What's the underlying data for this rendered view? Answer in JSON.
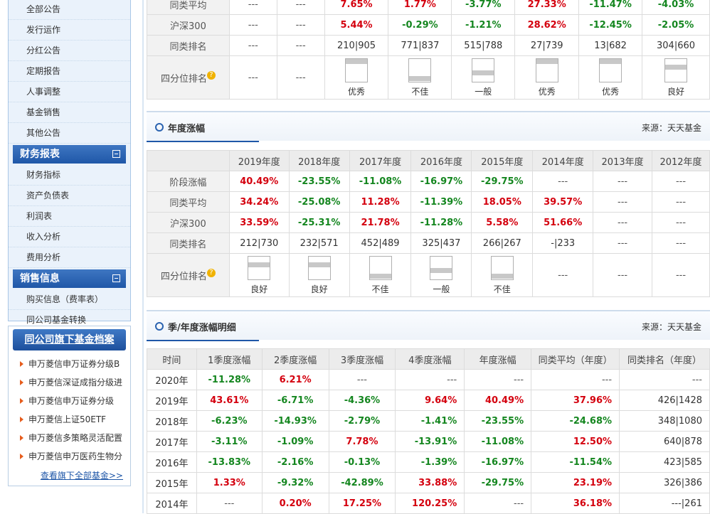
{
  "sidebar": {
    "notice_items": [
      "全部公告",
      "发行运作",
      "分红公告",
      "定期报告",
      "人事调整",
      "基金销售",
      "其他公告"
    ],
    "finance_head": "财务报表",
    "finance_items": [
      "财务指标",
      "资产负债表",
      "利润表",
      "收入分析",
      "费用分析"
    ],
    "sales_head": "销售信息",
    "sales_items": [
      "购买信息（费率表）",
      "同公司基金转换"
    ],
    "fund_head": "同公司旗下基金档案",
    "fund_items": [
      "申万菱信申万证券分级B",
      "申万菱信深证成指分级进",
      "申万菱信申万证券分级",
      "申万菱信上证50ETF",
      "申万菱信多策略灵活配置",
      "申万菱信申万医药生物分"
    ],
    "fund_more": "查看旗下全部基金>>"
  },
  "stage_table": {
    "rows": [
      {
        "label": "同类平均",
        "cells": [
          [
            "---",
            "d"
          ],
          [
            "---",
            "d"
          ],
          [
            "7.65%",
            "r"
          ],
          [
            "1.77%",
            "r"
          ],
          [
            "-3.77%",
            "g"
          ],
          [
            "27.33%",
            "r"
          ],
          [
            "-11.47%",
            "g"
          ],
          [
            "-4.03%",
            "g"
          ]
        ]
      },
      {
        "label": "沪深300",
        "cells": [
          [
            "---",
            "d"
          ],
          [
            "---",
            "d"
          ],
          [
            "5.44%",
            "r"
          ],
          [
            "-0.29%",
            "g"
          ],
          [
            "-1.21%",
            "g"
          ],
          [
            "28.62%",
            "r"
          ],
          [
            "-12.45%",
            "g"
          ],
          [
            "-2.05%",
            "g"
          ]
        ]
      },
      {
        "label": "同类排名",
        "cells": [
          [
            "---",
            "d"
          ],
          [
            "---",
            "d"
          ],
          [
            "210|905",
            "n"
          ],
          [
            "771|837",
            "n"
          ],
          [
            "515|788",
            "n"
          ],
          [
            "27|739",
            "n"
          ],
          [
            "13|682",
            "n"
          ],
          [
            "304|660",
            "n"
          ]
        ]
      }
    ],
    "quartile_label": "四分位排名",
    "quartiles": [
      null,
      null,
      {
        "t": "优秀",
        "lvl": 4
      },
      {
        "t": "不佳",
        "lvl": 1
      },
      {
        "t": "一般",
        "lvl": 2
      },
      {
        "t": "优秀",
        "lvl": 4
      },
      {
        "t": "优秀",
        "lvl": 4
      },
      {
        "t": "良好",
        "lvl": 3
      }
    ]
  },
  "annual": {
    "title": "年度涨幅",
    "source": "来源：天天基金",
    "headers": [
      "",
      "2019年度",
      "2018年度",
      "2017年度",
      "2016年度",
      "2015年度",
      "2014年度",
      "2013年度",
      "2012年度"
    ],
    "rows": [
      {
        "label": "阶段涨幅",
        "cells": [
          [
            "40.49%",
            "r"
          ],
          [
            "-23.55%",
            "g"
          ],
          [
            "-11.08%",
            "g"
          ],
          [
            "-16.97%",
            "g"
          ],
          [
            "-29.75%",
            "g"
          ],
          [
            "---",
            "d"
          ],
          [
            "---",
            "d"
          ],
          [
            "---",
            "d"
          ]
        ]
      },
      {
        "label": "同类平均",
        "cells": [
          [
            "34.24%",
            "r"
          ],
          [
            "-25.08%",
            "g"
          ],
          [
            "11.28%",
            "r"
          ],
          [
            "-11.39%",
            "g"
          ],
          [
            "18.05%",
            "r"
          ],
          [
            "39.57%",
            "r"
          ],
          [
            "---",
            "d"
          ],
          [
            "---",
            "d"
          ]
        ]
      },
      {
        "label": "沪深300",
        "cells": [
          [
            "33.59%",
            "r"
          ],
          [
            "-25.31%",
            "g"
          ],
          [
            "21.78%",
            "r"
          ],
          [
            "-11.28%",
            "g"
          ],
          [
            "5.58%",
            "r"
          ],
          [
            "51.66%",
            "r"
          ],
          [
            "---",
            "d"
          ],
          [
            "---",
            "d"
          ]
        ]
      },
      {
        "label": "同类排名",
        "cells": [
          [
            "212|730",
            "n"
          ],
          [
            "232|571",
            "n"
          ],
          [
            "452|489",
            "n"
          ],
          [
            "325|437",
            "n"
          ],
          [
            "266|267",
            "n"
          ],
          [
            "-|233",
            "n"
          ],
          [
            "---",
            "d"
          ],
          [
            "---",
            "d"
          ]
        ]
      }
    ],
    "quartile_label": "四分位排名",
    "quartiles": [
      {
        "t": "良好",
        "lvl": 3
      },
      {
        "t": "良好",
        "lvl": 3
      },
      {
        "t": "不佳",
        "lvl": 1
      },
      {
        "t": "一般",
        "lvl": 2
      },
      {
        "t": "不佳",
        "lvl": 1
      },
      null,
      null,
      null
    ]
  },
  "quarterly": {
    "title": "季/年度涨幅明细",
    "source": "来源：天天基金",
    "headers": [
      "时间",
      "1季度涨幅",
      "2季度涨幅",
      "3季度涨幅",
      "4季度涨幅",
      "年度涨幅",
      "同类平均（年度）",
      "同类排名（年度）"
    ],
    "rows": [
      [
        "2020年",
        [
          "-11.28%",
          "g"
        ],
        [
          "6.21%",
          "r"
        ],
        [
          "---",
          "d"
        ],
        [
          "---",
          "d"
        ],
        [
          "---",
          "d"
        ],
        [
          "---",
          "d"
        ],
        [
          "---",
          "d"
        ]
      ],
      [
        "2019年",
        [
          "43.61%",
          "r"
        ],
        [
          "-6.71%",
          "g"
        ],
        [
          "-4.36%",
          "g"
        ],
        [
          "9.64%",
          "r"
        ],
        [
          "40.49%",
          "r"
        ],
        [
          "37.96%",
          "r"
        ],
        [
          "426|1428",
          "n"
        ]
      ],
      [
        "2018年",
        [
          "-6.23%",
          "g"
        ],
        [
          "-14.93%",
          "g"
        ],
        [
          "-2.79%",
          "g"
        ],
        [
          "-1.41%",
          "g"
        ],
        [
          "-23.55%",
          "g"
        ],
        [
          "-24.68%",
          "g"
        ],
        [
          "348|1080",
          "n"
        ]
      ],
      [
        "2017年",
        [
          "-3.11%",
          "g"
        ],
        [
          "-1.09%",
          "g"
        ],
        [
          "7.78%",
          "r"
        ],
        [
          "-13.91%",
          "g"
        ],
        [
          "-11.08%",
          "g"
        ],
        [
          "12.50%",
          "r"
        ],
        [
          "640|878",
          "n"
        ]
      ],
      [
        "2016年",
        [
          "-13.83%",
          "g"
        ],
        [
          "-2.16%",
          "g"
        ],
        [
          "-0.13%",
          "g"
        ],
        [
          "-1.39%",
          "g"
        ],
        [
          "-16.97%",
          "g"
        ],
        [
          "-11.54%",
          "g"
        ],
        [
          "423|585",
          "n"
        ]
      ],
      [
        "2015年",
        [
          "1.33%",
          "r"
        ],
        [
          "-9.32%",
          "g"
        ],
        [
          "-42.89%",
          "g"
        ],
        [
          "33.88%",
          "r"
        ],
        [
          "-29.75%",
          "g"
        ],
        [
          "23.19%",
          "r"
        ],
        [
          "326|386",
          "n"
        ]
      ],
      [
        "2014年",
        [
          "---",
          "d"
        ],
        [
          "0.20%",
          "r"
        ],
        [
          "17.25%",
          "r"
        ],
        [
          "120.25%",
          "r"
        ],
        [
          "---",
          "d"
        ],
        [
          "36.18%",
          "r"
        ],
        [
          "---|261",
          "n"
        ]
      ]
    ]
  }
}
